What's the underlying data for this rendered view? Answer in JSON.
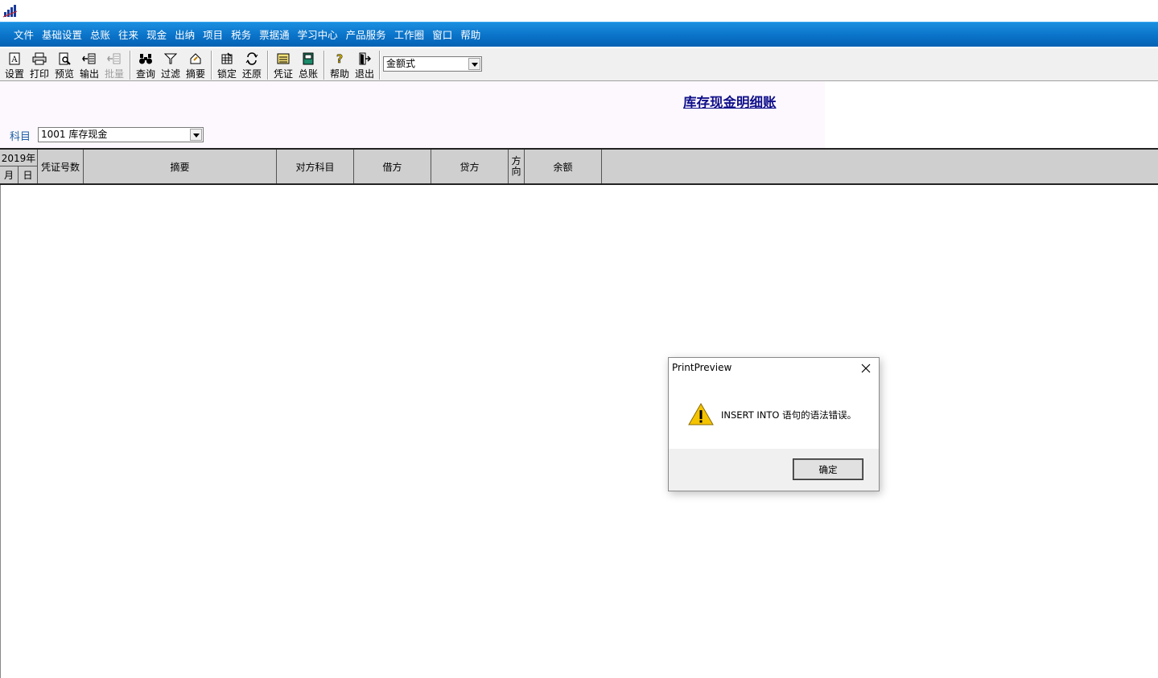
{
  "menubar": {
    "items": [
      "文件",
      "基础设置",
      "总账",
      "往来",
      "现金",
      "出纳",
      "项目",
      "税务",
      "票据通",
      "学习中心",
      "产品服务",
      "工作圈",
      "窗口",
      "帮助"
    ]
  },
  "toolbar": {
    "buttons": [
      {
        "label": "设置",
        "icon": "page-setup-icon",
        "enabled": true
      },
      {
        "label": "打印",
        "icon": "printer-icon",
        "enabled": true
      },
      {
        "label": "预览",
        "icon": "print-preview-icon",
        "enabled": true
      },
      {
        "label": "输出",
        "icon": "export-icon",
        "enabled": true
      },
      {
        "label": "批量",
        "icon": "batch-export-icon",
        "enabled": false
      },
      {
        "label": "查询",
        "icon": "binoculars-icon",
        "enabled": true
      },
      {
        "label": "过滤",
        "icon": "filter-icon",
        "enabled": true
      },
      {
        "label": "摘要",
        "icon": "summary-icon",
        "enabled": true
      },
      {
        "label": "锁定",
        "icon": "lock-grid-icon",
        "enabled": true
      },
      {
        "label": "还原",
        "icon": "restore-icon",
        "enabled": true
      },
      {
        "label": "凭证",
        "icon": "voucher-icon",
        "enabled": true
      },
      {
        "label": "总账",
        "icon": "ledger-book-icon",
        "enabled": true
      },
      {
        "label": "帮助",
        "icon": "help-icon",
        "enabled": true
      },
      {
        "label": "退出",
        "icon": "exit-icon",
        "enabled": true
      }
    ],
    "format_select": "金额式"
  },
  "report": {
    "title": "库存现金明细账",
    "subject_label": "科目",
    "subject_value": "1001  库存现金"
  },
  "grid": {
    "year": "2019年",
    "month": "月",
    "day": "日",
    "columns": {
      "voucher_no": "凭证号数",
      "summary": "摘要",
      "counter_account": "对方科目",
      "debit": "借方",
      "credit": "贷方",
      "direction": "方向",
      "balance": "余额"
    }
  },
  "dialog": {
    "title": "PrintPreview",
    "message": "INSERT INTO 语句的语法错误。",
    "ok_label": "确定"
  },
  "colors": {
    "menubar": "#0a73c9",
    "title_text": "#10108a",
    "grid_header": "#cfcfcf"
  }
}
